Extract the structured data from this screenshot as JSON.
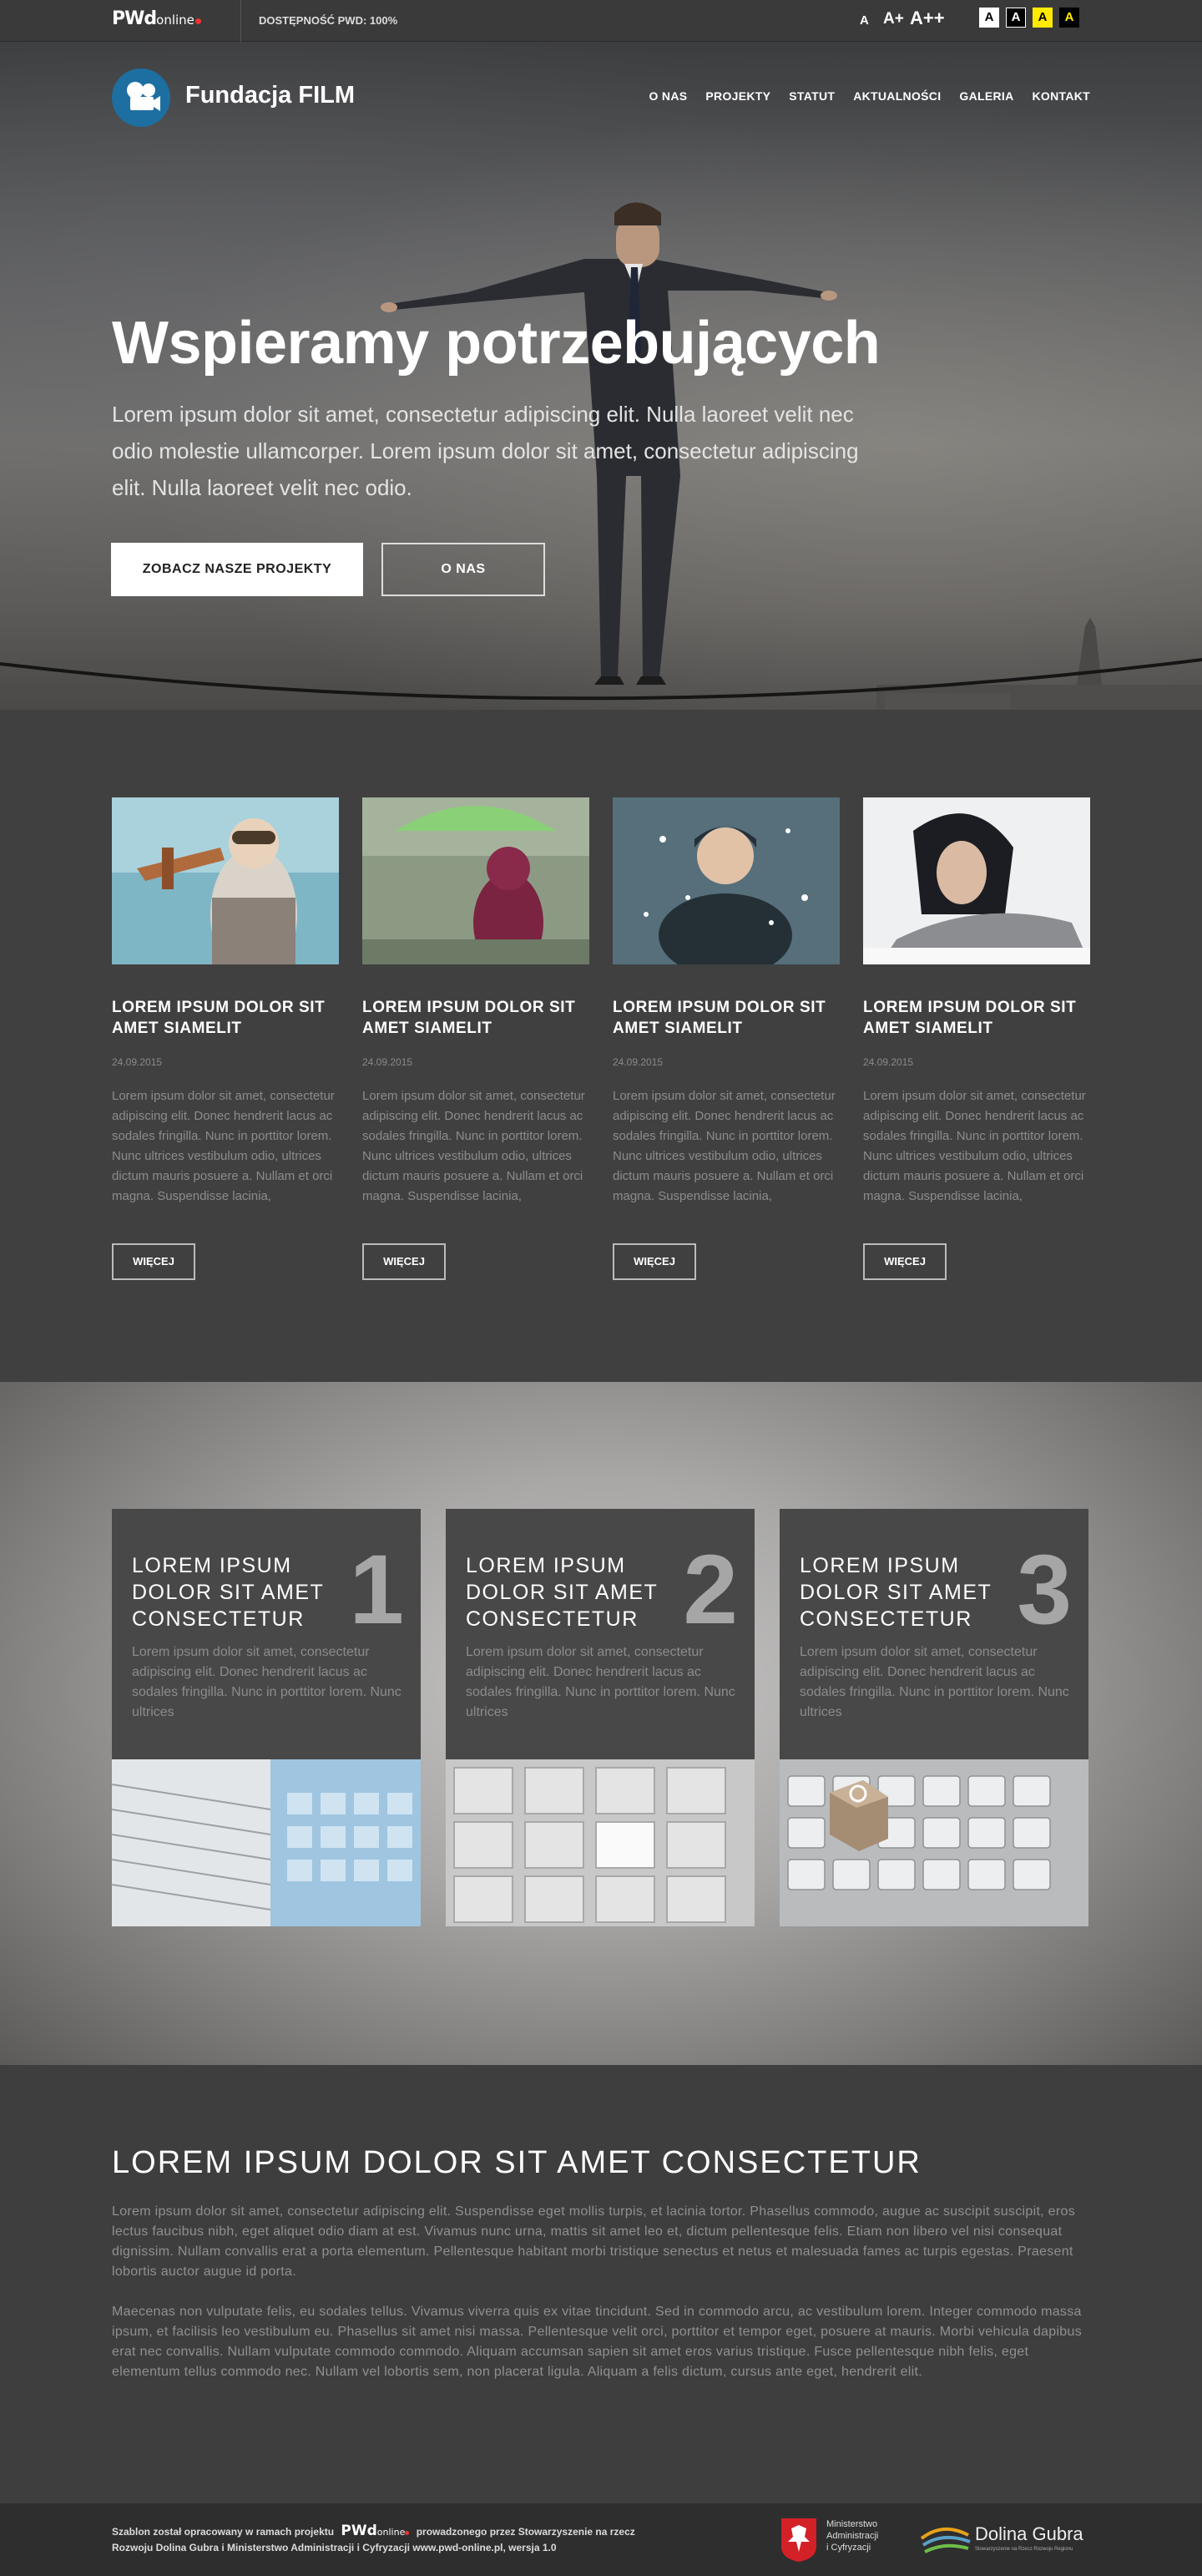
{
  "topbar": {
    "logo_main": "PWd",
    "logo_suffix": "online",
    "accessibility_label": "DOSTĘPNOŚĆ PWD: 100%",
    "font_sizes": [
      "A",
      "A+",
      "A++"
    ],
    "contrast_options": [
      "A",
      "A",
      "A",
      "A"
    ]
  },
  "header": {
    "brand": "Fundacja FILM",
    "nav": [
      "O NAS",
      "PROJEKTY",
      "STATUT",
      "AKTUALNOŚCI",
      "GALERIA",
      "KONTAKT"
    ]
  },
  "hero": {
    "title": "Wspieramy potrzebujących",
    "text": "Lorem ipsum dolor sit amet, consectetur adipiscing elit. Nulla laoreet velit nec odio molestie ullamcorper. Lorem ipsum dolor sit amet, consectetur adipiscing elit. Nulla laoreet velit nec odio.",
    "button_primary": "ZOBACZ NASZE PROJEKTY",
    "button_secondary": "O NAS"
  },
  "news": [
    {
      "title": "LOREM IPSUM DOLOR SIT AMET SIAMELIT",
      "date": "24.09.2015",
      "text": "Lorem ipsum dolor sit amet, consectetur adipiscing elit. Donec hendrerit lacus ac sodales fringilla. Nunc in porttitor lorem. Nunc ultrices vestibulum odio, ultrices dictum mauris posuere a. Nullam et orci magna. Suspendisse lacinia,",
      "button": "WIĘCEJ"
    },
    {
      "title": "LOREM IPSUM DOLOR SIT AMET SIAMELIT",
      "date": "24.09.2015",
      "text": "Lorem ipsum dolor sit amet, consectetur adipiscing elit. Donec hendrerit lacus ac sodales fringilla. Nunc in porttitor lorem. Nunc ultrices vestibulum odio, ultrices dictum mauris posuere a. Nullam et orci magna. Suspendisse lacinia,",
      "button": "WIĘCEJ"
    },
    {
      "title": "LOREM IPSUM DOLOR SIT AMET SIAMELIT",
      "date": "24.09.2015",
      "text": "Lorem ipsum dolor sit amet, consectetur adipiscing elit. Donec hendrerit lacus ac sodales fringilla. Nunc in porttitor lorem. Nunc ultrices vestibulum odio, ultrices dictum mauris posuere a. Nullam et orci magna. Suspendisse lacinia,",
      "button": "WIĘCEJ"
    },
    {
      "title": "LOREM IPSUM DOLOR SIT AMET SIAMELIT",
      "date": "24.09.2015",
      "text": "Lorem ipsum dolor sit amet, consectetur adipiscing elit. Donec hendrerit lacus ac sodales fringilla. Nunc in porttitor lorem. Nunc ultrices vestibulum odio, ultrices dictum mauris posuere a. Nullam et orci magna. Suspendisse lacinia,",
      "button": "WIĘCEJ"
    }
  ],
  "features": [
    {
      "title": "LOREM IPSUM DOLOR SIT AMET CONSECTETUR",
      "number": "1",
      "text": "Lorem ipsum dolor sit amet, consectetur adipiscing elit. Donec hendrerit lacus ac sodales fringilla. Nunc in porttitor lorem. Nunc ultrices"
    },
    {
      "title": "LOREM IPSUM DOLOR SIT AMET CONSECTETUR",
      "number": "2",
      "text": "Lorem ipsum dolor sit amet, consectetur adipiscing elit. Donec hendrerit lacus ac sodales fringilla. Nunc in porttitor lorem. Nunc ultrices"
    },
    {
      "title": "LOREM IPSUM DOLOR SIT AMET CONSECTETUR",
      "number": "3",
      "text": "Lorem ipsum dolor sit amet, consectetur adipiscing elit. Donec hendrerit lacus ac sodales fringilla. Nunc in porttitor lorem. Nunc ultrices"
    }
  ],
  "about": {
    "title": "LOREM IPSUM DOLOR SIT AMET CONSECTETUR",
    "paragraph1": "Lorem ipsum dolor sit amet, consectetur adipiscing elit. Suspendisse eget mollis turpis, et lacinia tortor. Phasellus commodo, augue ac suscipit suscipit, eros lectus faucibus nibh, eget aliquet odio diam at est. Vivamus nunc urna, mattis sit amet leo et, dictum pellentesque felis. Etiam non libero vel nisi consequat dignissim. Nullam convallis erat a porta elementum. Pellentesque habitant morbi tristique senectus et netus et malesuada fames ac turpis egestas. Praesent lobortis auctor augue id porta.",
    "paragraph2": "Maecenas non vulputate felis, eu sodales tellus. Vivamus viverra quis ex vitae tincidunt. Sed in commodo arcu, ac vestibulum lorem. Integer commodo massa ipsum, et facilisis leo vestibulum eu. Phasellus sit amet nisi massa. Pellentesque velit orci, porttitor et tempor eget, posuere at mauris. Morbi vehicula dapibus erat nec convallis. Nullam vulputate commodo commodo. Aliquam accumsan sapien sit amet eros varius tristique. Fusce pellentesque nibh felis, eget elementum tellus commodo nec. Nullam vel lobortis sem, non placerat ligula. Aliquam a felis dictum, cursus ante eget, hendrerit elit."
  },
  "footer": {
    "line1_before": "Szablon został opracowany w ramach projektu",
    "line1_after": "prowadzonego przez Stowarzyszenie na rzecz",
    "line2": "Rozwoju Dolina Gubra i Ministerstwo Administracji i Cyfryzacji www.pwd-online.pl, wersja 1.0",
    "logo_main": "PWd",
    "logo_suffix": "online",
    "ministry": [
      "Ministerstwo",
      "Administracji",
      "i Cyfryzacji"
    ],
    "dolina": "Dolina Gubra",
    "dolina_sub": "Stowarzyszenie na Rzecz Rozwoju Regionu"
  }
}
